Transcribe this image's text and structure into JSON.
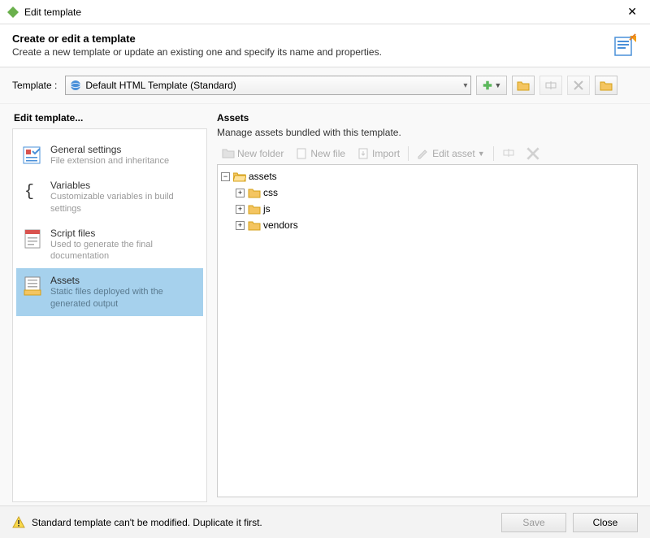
{
  "window": {
    "title": "Edit template"
  },
  "header": {
    "title": "Create or edit a template",
    "subtitle": "Create a new template or update an existing one and specify its name and properties."
  },
  "toolbar": {
    "label": "Template :",
    "selected": "Default HTML Template (Standard)"
  },
  "sidebar": {
    "title": "Edit template...",
    "items": [
      {
        "title": "General settings",
        "desc": "File extension and inheritance"
      },
      {
        "title": "Variables",
        "desc": "Customizable variables in build settings"
      },
      {
        "title": "Script files",
        "desc": "Used to generate the final documentation"
      },
      {
        "title": "Assets",
        "desc": "Static files deployed with the generated output"
      }
    ]
  },
  "assets": {
    "title": "Assets",
    "desc": "Manage assets bundled with this template.",
    "toolbar": {
      "new_folder": "New folder",
      "new_file": "New file",
      "import": "Import",
      "edit_asset": "Edit asset"
    },
    "tree": {
      "root": "assets",
      "children": [
        "css",
        "js",
        "vendors"
      ]
    }
  },
  "footer": {
    "warning": "Standard template can't be modified. Duplicate it first.",
    "save": "Save",
    "close": "Close"
  }
}
